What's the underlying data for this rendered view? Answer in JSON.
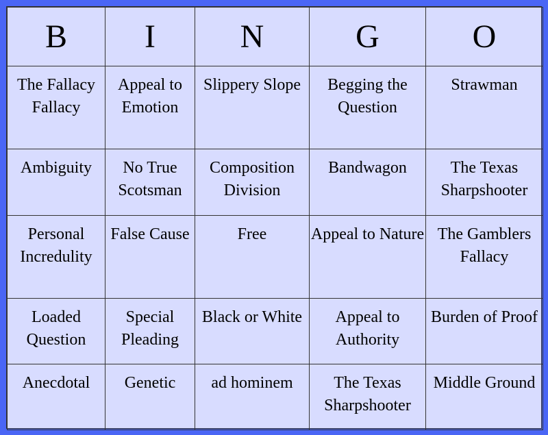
{
  "header": [
    "B",
    "I",
    "N",
    "G",
    "O"
  ],
  "rows": [
    [
      "The Fallacy Fallacy",
      "Appeal to Emotion",
      "Slippery Slope",
      "Begging the Question",
      "Strawman"
    ],
    [
      "Ambiguity",
      "No True Scotsman",
      "Composition Division",
      "Bandwagon",
      "The Texas Sharpshooter"
    ],
    [
      "Personal Incredulity",
      "False Cause",
      "Free",
      "Appeal to Nature",
      "The Gamblers Fallacy"
    ],
    [
      "Loaded Question",
      "Special Pleading",
      "Black or White",
      "Appeal to Authority",
      "Burden of Proof"
    ],
    [
      "Anecdotal",
      "Genetic",
      "ad hominem",
      "The Texas Sharpshooter",
      "Middle Ground"
    ]
  ],
  "colors": {
    "border_background": "#4a66f5",
    "card_background": "#d8dcff",
    "grid_line": "#333333",
    "text": "#000000"
  }
}
